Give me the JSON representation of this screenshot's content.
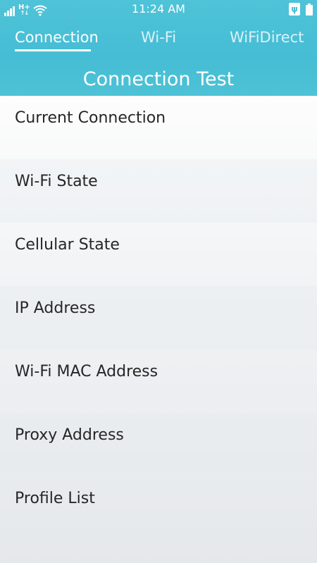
{
  "status_bar": {
    "network_type": "H+",
    "time": "11:24 AM",
    "icons": [
      "signal-icon",
      "hplus-data-icon",
      "wifi-icon",
      "usb-icon",
      "battery-icon"
    ]
  },
  "tabs": [
    {
      "label": "Connection",
      "active": true
    },
    {
      "label": "Wi-Fi",
      "active": false
    },
    {
      "label": "WiFiDirect",
      "active": false
    }
  ],
  "title": "Connection Test",
  "items": [
    {
      "label": "Current Connection"
    },
    {
      "label": "Wi-Fi State"
    },
    {
      "label": "Cellular State"
    },
    {
      "label": "IP Address"
    },
    {
      "label": "Wi-Fi MAC Address"
    },
    {
      "label": "Proxy Address"
    },
    {
      "label": "Profile List"
    }
  ],
  "colors": {
    "header": "#45bdd4",
    "text": "#262626",
    "background": "#e7eaed"
  }
}
